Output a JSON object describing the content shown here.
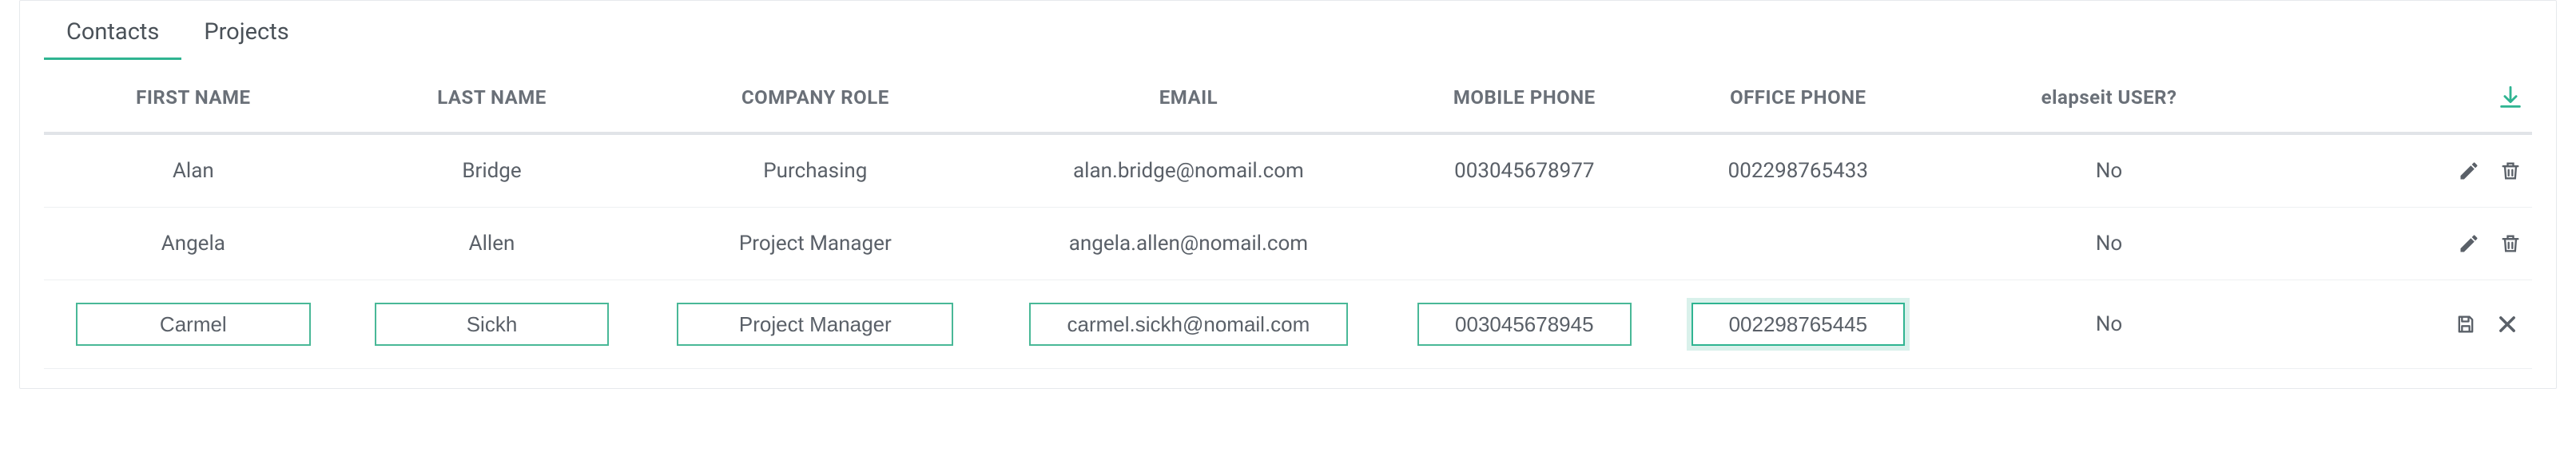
{
  "tabs": {
    "contacts": "Contacts",
    "projects": "Projects",
    "active": "contacts"
  },
  "columns": {
    "first_name": "FIRST NAME",
    "last_name": "LAST NAME",
    "company_role": "COMPANY ROLE",
    "email": "EMAIL",
    "mobile_phone": "MOBILE PHONE",
    "office_phone": "OFFICE PHONE",
    "elapseit_user": "elapseit USER?"
  },
  "rows": [
    {
      "first_name": "Alan",
      "last_name": "Bridge",
      "company_role": "Purchasing",
      "email": "alan.bridge@nomail.com",
      "mobile_phone": "003045678977",
      "office_phone": "002298765433",
      "elapseit_user": "No"
    },
    {
      "first_name": "Angela",
      "last_name": "Allen",
      "company_role": "Project Manager",
      "email": "angela.allen@nomail.com",
      "mobile_phone": "",
      "office_phone": "",
      "elapseit_user": "No"
    }
  ],
  "edit_row": {
    "first_name": "Carmel",
    "last_name": "Sickh",
    "company_role": "Project Manager",
    "email": "carmel.sickh@nomail.com",
    "mobile_phone": "003045678945",
    "office_phone": "002298765445",
    "elapseit_user": "No",
    "focused_field": "office_phone"
  },
  "icons": {
    "download": "download-icon",
    "edit": "pencil-icon",
    "delete": "trash-icon",
    "save": "save-icon",
    "cancel": "close-icon"
  },
  "colors": {
    "accent": "#2fb491",
    "border": "#e6e9ec",
    "text": "#5a6068"
  }
}
